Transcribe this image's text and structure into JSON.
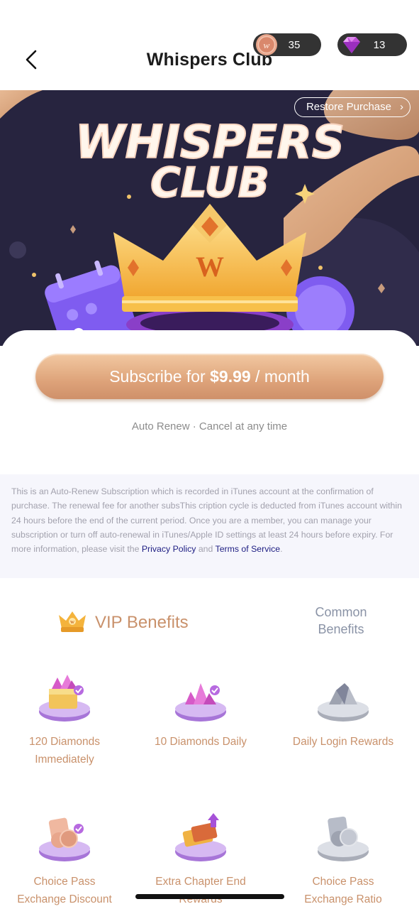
{
  "header": {
    "title": "Whispers Club",
    "coins": "35",
    "gems": "13"
  },
  "banner": {
    "restore_label": "Restore Purchase",
    "chevron_glyph": "›",
    "headline_line1": "WHISPERS",
    "headline_line2": "CLUB",
    "crown_letter": "W"
  },
  "subscribe": {
    "prefix": "Subscribe for ",
    "price": "$9.99",
    "suffix": " / month",
    "auto_renew": "Auto Renew · Cancel at any time"
  },
  "terms": {
    "text": "This is an Auto-Renew Subscription which is recorded in iTunes account at the confirmation of purchase. The renewal fee for another subsThis cription cycle is deducted from iTunes account within 24 hours before the end of the current period. Once you are a member, you can manage your subscription or turn off auto-renewal in iTunes/Apple ID settings at least 24 hours before expiry. For more information, please visit the ",
    "privacy_link": "Privacy Policy",
    "and": " and ",
    "tos_link": "Terms of Service",
    "period": "."
  },
  "benefits": {
    "vip_title": "VIP Benefits",
    "common_title_line1": "Common",
    "common_title_line2": "Benefits",
    "items": [
      {
        "line1": "120 Diamonds",
        "line2": "Immediately",
        "icon": "diamond-chest-icon"
      },
      {
        "line1": "10 Diamonds Daily",
        "line2": "",
        "icon": "diamond-pile-icon"
      },
      {
        "line1": "Daily Login Rewards",
        "line2": "",
        "icon": "silver-diamond-icon"
      },
      {
        "line1": "Choice Pass",
        "line2": "Exchange Discount",
        "icon": "choice-pass-coin-icon"
      },
      {
        "line1": "Extra Chapter End",
        "line2": "Rewards",
        "icon": "chapter-ticket-icon"
      },
      {
        "line1": "Choice Pass",
        "line2": "Exchange Ratio",
        "icon": "silver-coin-icon"
      }
    ]
  },
  "colors": {
    "accent": "#c9916b",
    "button_gold": "#dea37a",
    "banner_bg": "#27243f",
    "link": "#1d1d82"
  }
}
